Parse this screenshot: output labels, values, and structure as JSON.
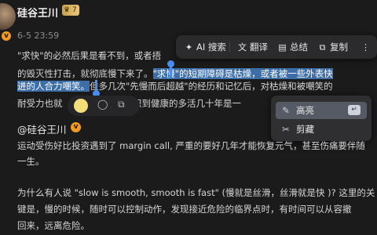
{
  "post": {
    "author": "硅谷王川",
    "vip_badge": "7",
    "time": "6-5 23:59",
    "lines": [
      [
        "\"求快\"的必然后果是看不到，或者捂",
        "",
        ""
      ],
      [
        "的毁灭性打击，就彻底慢下来了。",
        "\"求慢\"的短期障碍是枯燥，或者被一些外表快",
        ""
      ],
      [
        "",
        "进的人合力嘲笑。",
        "但多几次\"先慢而后超越\"的经历和记忆后，对枯燥和被嘲笑的"
      ],
      [
        "耐受力也就",
        "",
        "意识到健康的多活几十年是一"
      ]
    ]
  },
  "toolbar": {
    "ai": "AI 搜索",
    "translate": "翻译",
    "summary": "总结",
    "copy": "复制"
  },
  "popup": {
    "highlight": "高亮",
    "clip": "剪藏",
    "enter_key": "↵"
  },
  "quote": {
    "author": "@硅谷王川",
    "lines": [
      "运动受伤好比投资遇到了 margin call, 严重的要好几年才能恢复元气，甚至伤痛要伴随",
      "一生。",
      "",
      "为什么有人说 \"slow is smooth, smooth is fast\" (慢就是丝滑，丝滑就是快 )? 这里的关",
      "键是，慢的时候，随时可以控制动作，发现接近危险的临界点时，有时间可以从容撤",
      "回来，远离危险。"
    ]
  },
  "colors": {
    "highlight": "#3d6ea8",
    "handle": "#4a8cf0",
    "badge": "#f29b1f"
  }
}
